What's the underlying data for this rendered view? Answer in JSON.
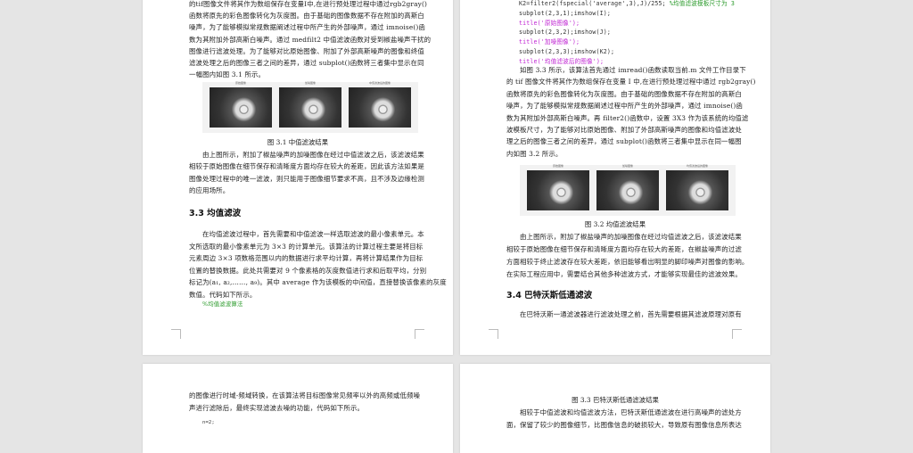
{
  "page1": {
    "para1": [
      "的tif图像文件将其作为数组保存在变量I中,在进行预处理过程中通过rgb2gray()",
      "函数将原先的彩色图像转化为灰度图。由于基础的图像数据不存在附加的高斯白",
      "噪声，为了能够模拟常规数据阐述过程中所产生的外部噪声，通过 imnoise()函",
      "数为其附加外部高斯白噪声。通过 medfilt2 中值滤波函数对受到椒盐噪声干扰的",
      "图像进行滤波处理。为了能够对比原始图像、附加了外部高斯噪声的图像和终值",
      "滤波处理之后的图像三者之间的差异，通过 subplot()函数将三者集中显示在同",
      "一幅图内如图 3.1 所示。"
    ],
    "figure_titles": [
      "原始图像",
      "加噪图像",
      "中值滤波后的图像"
    ],
    "caption": "图 3.1 中值滤波结果",
    "para2": [
      "由上图所示，附加了椒盐噪声的加噪图像在经过中值滤波之后，该滤波结果",
      "相较于原始图像在细节保存和清晰度方面均存在较大的差距，因此该方法如果是",
      "图像处理过程中的唯一滤波，则只能用于图像细节要求不高，且不涉及边缘检测",
      "的应用场所。"
    ],
    "heading": "3.3 均值滤波",
    "para3": [
      "在均值滤波过程中，首先需要和中值滤波一样选取滤波的最小像素单元。本",
      "文所选取的最小像素单元为 3×3 的计算单元。该算法的计算过程主要是将目标",
      "元素周边 3×3 项数格范围以内的数据进行求平均计算，再将计算结果作为目标",
      "位置的替换数据。此处共需要对 9 个像素格的灰度数值进行求和后取平均，分别",
      "标记为(a₁, a₂,……, a₉)。其中 average 作为该模板的中间值，直接替换该像素的灰度",
      "数值。代码如下所示。"
    ],
    "code_comment": "%均值滤波算法"
  },
  "page2": {
    "code": [
      "K2=filter2(fspecial('average',3),J)/255; %均值滤波模板尺寸为 3",
      "subplot(2,3,1);imshow(I);",
      "title('原始图像');",
      "subplot(2,3,2);imshow(J);",
      "title('加噪图像');",
      "subplot(2,3,3);imshow(K2);",
      "title('均值滤波后的图像');"
    ],
    "para1": [
      "如图 3.3 所示，该算法首先通过 imread()函数读取当前.m 文件工作目录下",
      "的 tif 图像文件将其作为数组保存在变量 I 中,在进行预处理过程中通过 rgb2gray()",
      "函数将原先的彩色图像转化为灰度图。由于基础的图像数据不存在附加的高斯白",
      "噪声，为了能够模拟常规数据阐述过程中所产生的外部噪声，通过 imnoise()函",
      "数为其附加外部高斯白噪声。再 filter2()函数中，设置 3X3 作为该系统的均值滤",
      "波模板尺寸，为了能够对比原始图像、附加了外部高斯噪声的图像和均值滤波处",
      "理之后的图像三者之间的差异，通过 subplot()函数将三者集中显示在同一幅图",
      "内如图 3.2 所示。"
    ],
    "figure_titles": [
      "原始图像",
      "加噪图像",
      "均值滤波后的图像"
    ],
    "caption": "图 3.2 均值滤波结果",
    "para2": [
      "由上图所示，附加了椒盐噪声的加噪图像在经过均值滤波之后，该滤波结果",
      "相较于原始图像在细节保存和清晰度方面均存在较大的差距，在椒盐噪声的过滤",
      "方面相较于终止滤波存在较大差距，依旧能够看出明显的脚印噪声对图像的影响。",
      "在实际工程应用中，需要结合其他多种滤波方式，才能够实现最佳的滤波效果。"
    ],
    "heading": "3.4 巴特沃斯低通滤波",
    "para3": [
      "在巴特沃斯一通滤波器进行滤波处理之前，首先需要根据其滤波原理对原有"
    ]
  },
  "page3": {
    "lines": [
      "的图像进行时域-频域转换，在该算法将目标图像常见频率以外的高频或低频噪",
      "声进行滤除后，最终实现滤波去噪的功能，代码如下所示。"
    ],
    "code": "n=2;"
  },
  "page4": {
    "caption": "图 3.3 巴特沃斯低通滤波结果",
    "lines": [
      "相较于中值滤波和均值滤波方法，巴特沃斯低通滤波在进行高噪声的滤处方",
      "面，保留了较少的图像细节，比图像信息的破损较大，导致原有图像信息所表达"
    ]
  }
}
